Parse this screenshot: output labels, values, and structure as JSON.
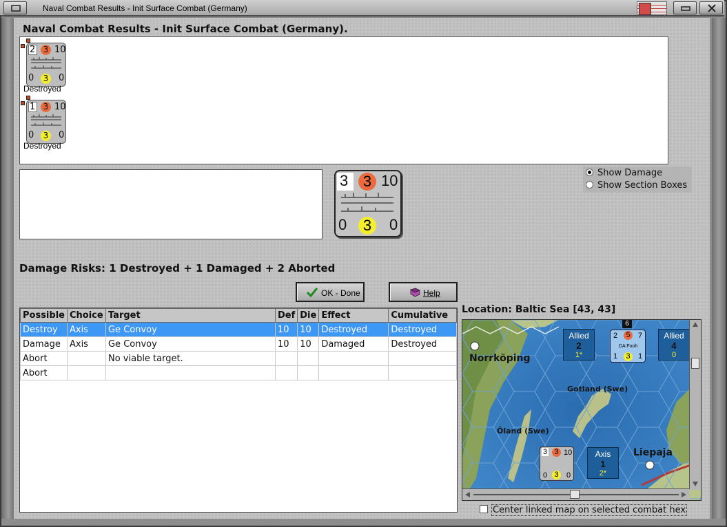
{
  "window": {
    "title": "Naval Combat Results - Init Surface Combat (Germany)"
  },
  "dialog": {
    "heading": "Naval Combat Results - Init Surface Combat (Germany)."
  },
  "units": [
    {
      "index": "2",
      "attack": "3",
      "range": "10",
      "left": "0",
      "mid": "3",
      "right": "0",
      "status": "Destroyed"
    },
    {
      "index": "1",
      "attack": "3",
      "range": "10",
      "left": "0",
      "mid": "3",
      "right": "0",
      "status": "Destroyed"
    }
  ],
  "selected_unit": {
    "index": "3",
    "attack": "3",
    "range": "10",
    "left": "0",
    "mid": "3",
    "right": "0"
  },
  "display_options": {
    "show_damage": "Show Damage",
    "show_section_boxes": "Show Section Boxes",
    "selected": "show_damage"
  },
  "damage_risks": "Damage Risks:  1 Destroyed + 1 Damaged + 2 Aborted",
  "buttons": {
    "ok": "OK - Done",
    "help": "Help"
  },
  "table": {
    "columns": [
      "Possible",
      "Choice",
      "Target",
      "Def",
      "Die",
      "Effect",
      "Cumulative"
    ],
    "rows": [
      [
        "Destroy",
        "Axis",
        "Ge Convoy",
        "10",
        "10",
        "Destroyed",
        "Destroyed"
      ],
      [
        "Damage",
        "Axis",
        "Ge Convoy",
        "10",
        "10",
        "Damaged",
        "Destroyed"
      ],
      [
        "Abort",
        "",
        "No viable target.",
        "",
        "",
        "",
        ""
      ],
      [
        "Abort",
        "",
        "",
        "",
        "",
        "",
        ""
      ]
    ],
    "selected_row": 0
  },
  "location": "Location:  Baltic Sea [43, 43]",
  "map": {
    "labels": {
      "norrkoping": "Norrköping",
      "gotland": "Gotland (Swe)",
      "oland": "Öland (Swe)",
      "liepaja": "Liepaja"
    },
    "boxes": [
      {
        "title": "Allied",
        "value": "2",
        "sub": "1*"
      },
      {
        "title": "Allied",
        "value": "4",
        "sub": "0"
      },
      {
        "title": "Axis",
        "value": "1",
        "sub": "2*"
      }
    ],
    "allied_counter": {
      "a": "2",
      "b": "5",
      "c": "7",
      "name": "DA Fooh",
      "d": "1",
      "e": "3",
      "f": "1",
      "stack": "6"
    },
    "axis_counter": {
      "a": "3",
      "b": "3",
      "c": "10",
      "d": "0",
      "e": "3",
      "f": "0"
    }
  },
  "center_map_checkbox": "Center linked map on selected combat hex",
  "colors": {
    "selection": "#3d97f5",
    "sea": "#2f74b7",
    "attack_circle": "#ea6a3e",
    "defense_circle": "#f3ef2e"
  }
}
